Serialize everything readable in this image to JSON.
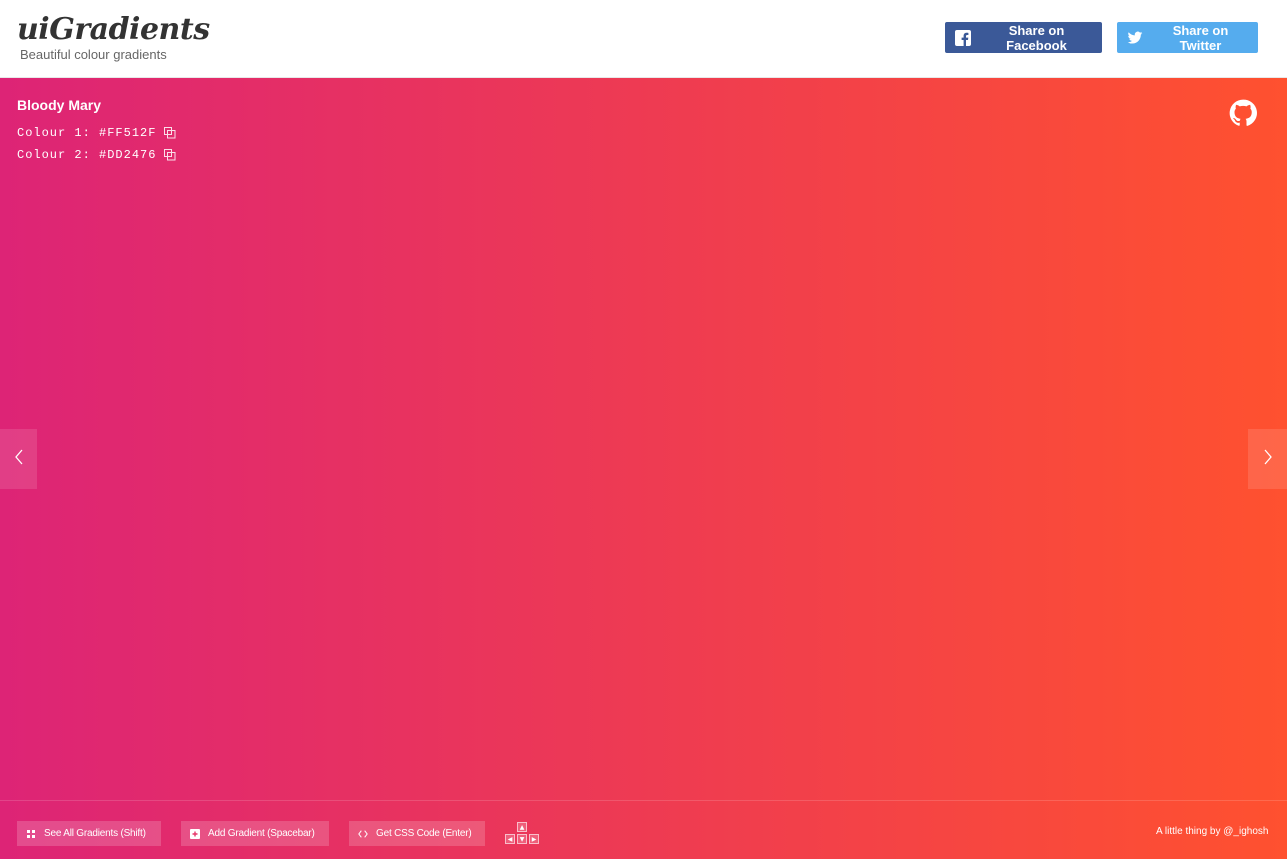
{
  "header": {
    "logo": "uiGradients",
    "tagline": "Beautiful colour gradients",
    "share_facebook": "Share on Facebook",
    "share_twitter": "Share on Twitter"
  },
  "gradient": {
    "name": "Bloody Mary",
    "colour1_label": "Colour 1: #FF512F",
    "colour2_label": "Colour 2: #DD2476",
    "colour1": "#FF512F",
    "colour2": "#DD2476"
  },
  "footer": {
    "see_all": "See All Gradients (Shift)",
    "add_gradient": "Add Gradient (Spacebar)",
    "get_css": "Get CSS Code (Enter)",
    "credit": "A little thing by @_ighosh"
  },
  "colors": {
    "facebook": "#3b5998",
    "twitter": "#55acee"
  },
  "icons": [
    "facebook-icon",
    "twitter-icon",
    "copy-icon",
    "github-icon",
    "chevron-left-icon",
    "chevron-right-icon",
    "grid-icon",
    "plus-square-icon",
    "code-icon",
    "arrow-keys-icon"
  ]
}
